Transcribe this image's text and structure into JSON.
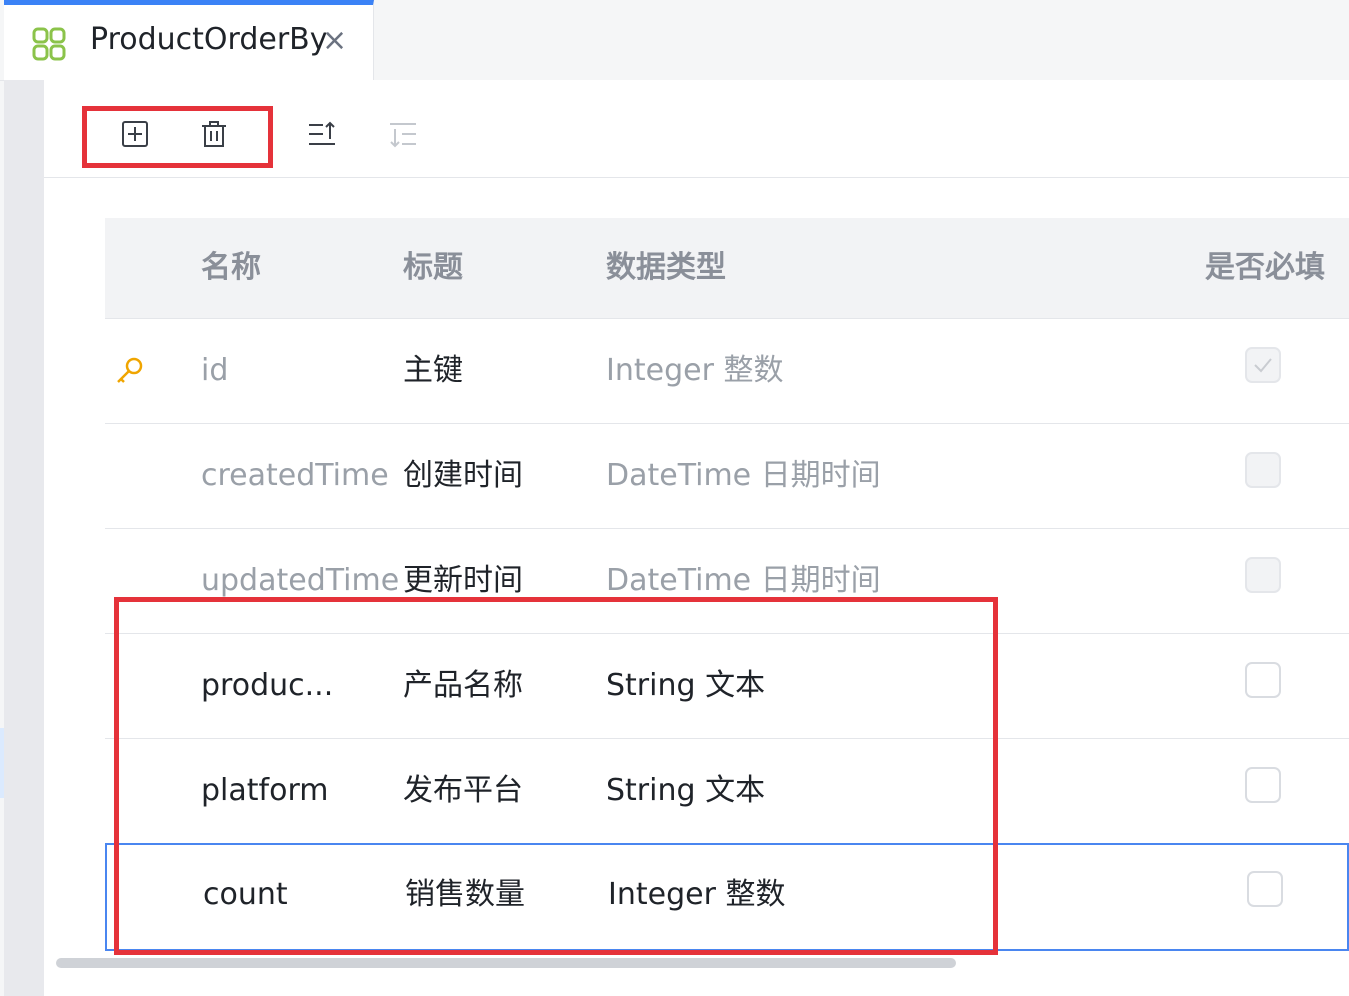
{
  "tab": {
    "title": "ProductOrderBy",
    "close_glyph": "×",
    "icon": "app-grid-icon"
  },
  "toolbar": {
    "buttons": [
      {
        "name": "add",
        "icon": "plus-square-icon"
      },
      {
        "name": "delete",
        "icon": "trash-icon"
      },
      {
        "name": "move-up",
        "icon": "sort-up-icon"
      },
      {
        "name": "move-down",
        "icon": "sort-down-icon",
        "disabled": true
      }
    ]
  },
  "table": {
    "headers": {
      "name": "名称",
      "title": "标题",
      "type": "数据类型",
      "required": "是否必填"
    },
    "rows": [
      {
        "name": "id",
        "title": "主键",
        "type": "Integer 整数",
        "primary_key": true,
        "required": true,
        "locked": true
      },
      {
        "name": "createdTime",
        "title": "创建时间",
        "type": "DateTime 日期时间",
        "required": false,
        "locked": true
      },
      {
        "name": "updatedTime",
        "title": "更新时间",
        "type": "DateTime 日期时间",
        "required": false,
        "locked": true
      },
      {
        "name": "produc...",
        "title": "产品名称",
        "type": "String 文本",
        "required": false,
        "locked": false
      },
      {
        "name": "platform",
        "title": "发布平台",
        "type": "String 文本",
        "required": false,
        "locked": false
      },
      {
        "name": "count",
        "title": "销售数量",
        "type": "Integer 整数",
        "required": false,
        "locked": false,
        "selected": true
      }
    ]
  },
  "colors": {
    "accent": "#3b82f6",
    "highlight": "#e5323a",
    "key": "#f0a500"
  }
}
